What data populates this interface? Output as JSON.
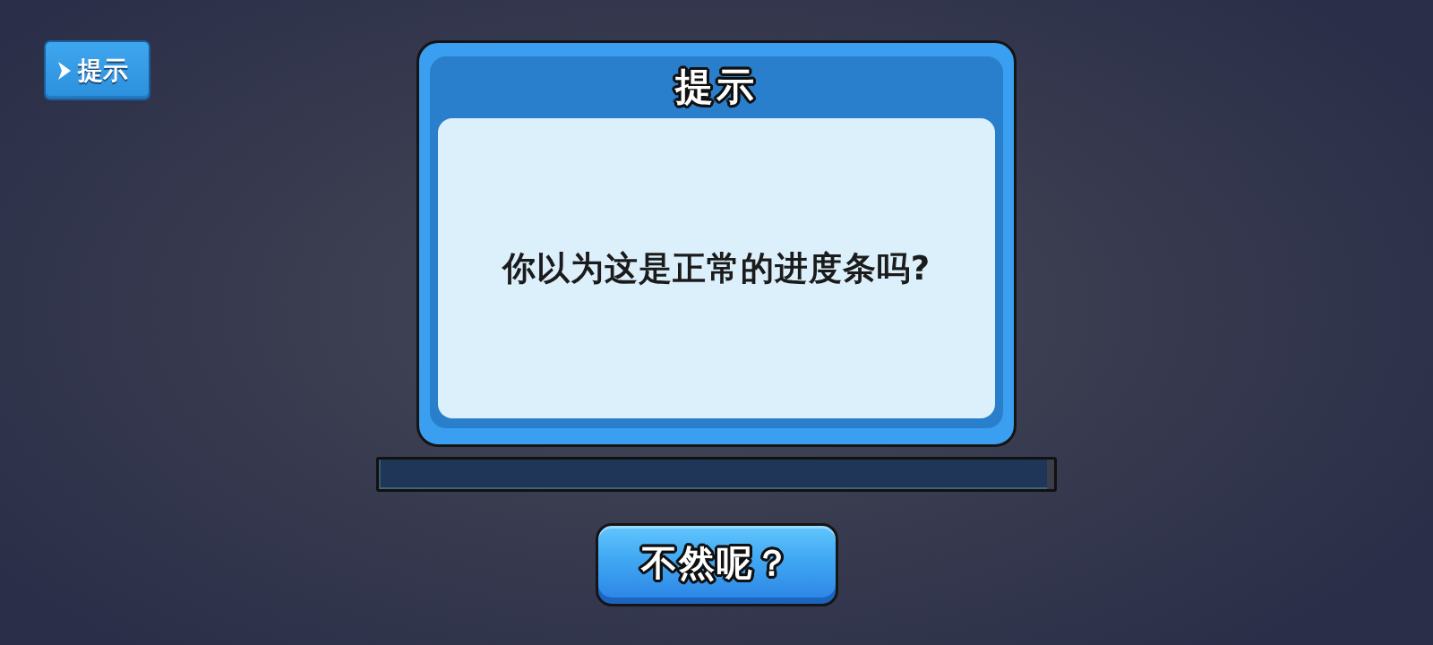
{
  "hint_button": {
    "label": "提示"
  },
  "dialog": {
    "title": "提示",
    "message": "你以为这是正常的进度条吗?"
  },
  "progress_bar": {
    "level": 0.99
  },
  "buttons": [
    {
      "label": "不然呢？"
    }
  ]
}
